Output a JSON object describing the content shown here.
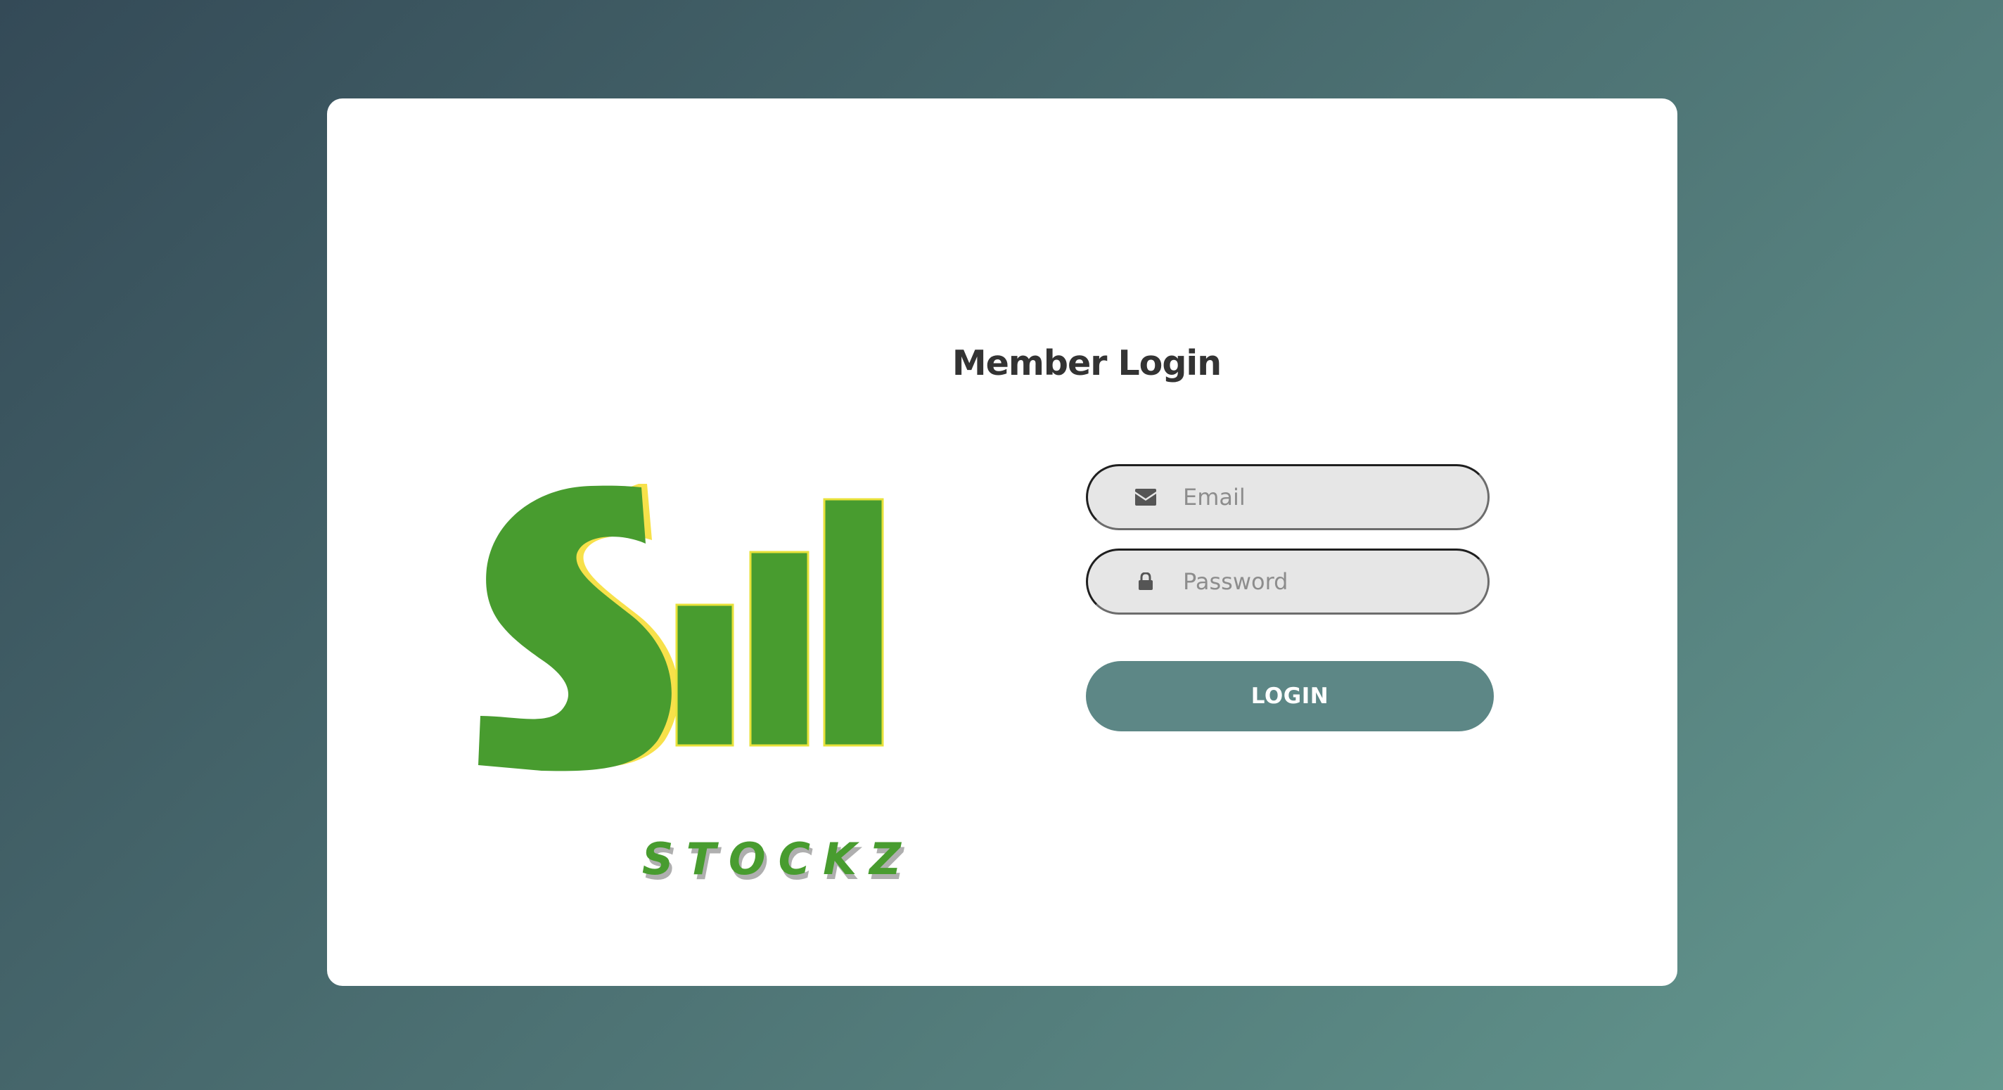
{
  "logo": {
    "brand_text": "STOCKZ",
    "colors": {
      "green": "#489c2f",
      "yellow": "#f7e14a",
      "bar_stroke": "#e8e23a"
    }
  },
  "login": {
    "title": "Member Login",
    "email": {
      "placeholder": "Email",
      "value": "",
      "icon": "envelope-icon"
    },
    "password": {
      "placeholder": "Password",
      "value": "",
      "icon": "lock-icon"
    },
    "button_label": "LOGIN"
  },
  "colors": {
    "background_start": "#344a57",
    "background_end": "#64988f",
    "button": "#5d8786",
    "title": "#333333"
  }
}
